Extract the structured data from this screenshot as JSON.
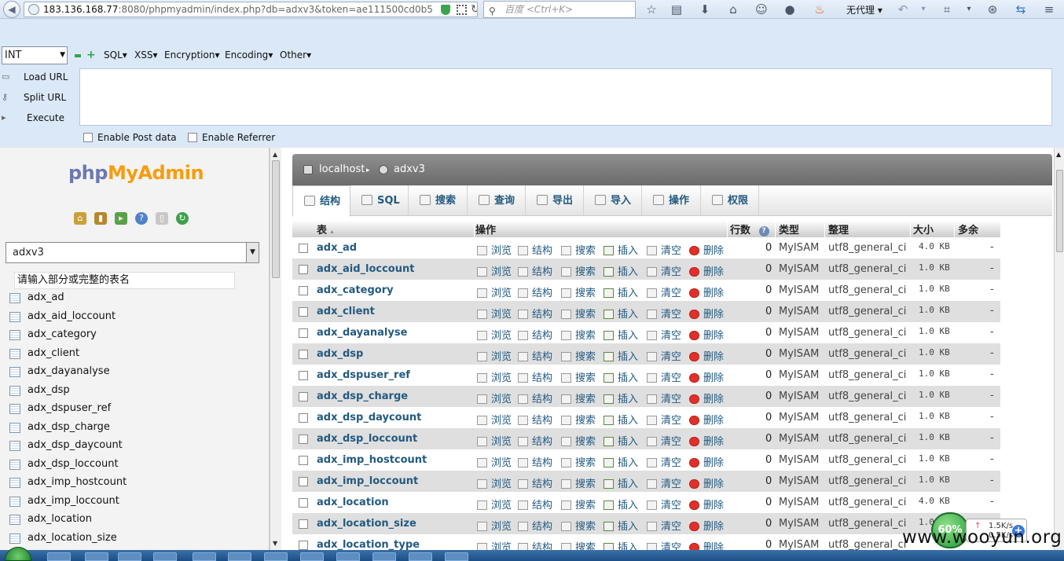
{
  "browser": {
    "url_host": "183.136.168.77",
    "url_rest": ":8080/phpmyadmin/index.php?db=adxv3&token=ae111500cd0b5",
    "search_placeholder": "百度 <Ctrl+K>",
    "proxy_label": "无代理",
    "icons": [
      "back-icon",
      "globe-icon",
      "shield-icon",
      "qr-icon",
      "reload-icon",
      "search-icon",
      "star-icon",
      "bookmarks-icon",
      "download-icon",
      "home-icon",
      "chat-icon",
      "comment-icon",
      "fire-icon",
      "undo-icon",
      "crop-icon",
      "globe-settings-icon",
      "sync-icon",
      "menu-icon"
    ]
  },
  "hackbar": {
    "type_select": "INT",
    "menus": [
      "SQL",
      "XSS",
      "Encryption",
      "Encoding",
      "Other"
    ],
    "load_url": "Load URL",
    "split_url": "Split URL",
    "execute": "Execute",
    "post_label": "Enable Post data",
    "referrer_label": "Enable Referrer"
  },
  "sidebar": {
    "logo_php": "php",
    "logo_my": "My",
    "logo_admin": "Admin",
    "db_selected": "adxv3",
    "filter_placeholder": "请输入部分或完整的表名",
    "tables": [
      "adx_ad",
      "adx_aid_loccount",
      "adx_category",
      "adx_client",
      "adx_dayanalyse",
      "adx_dsp",
      "adx_dspuser_ref",
      "adx_dsp_charge",
      "adx_dsp_daycount",
      "adx_dsp_loccount",
      "adx_imp_hostcount",
      "adx_imp_loccount",
      "adx_location",
      "adx_location_size"
    ]
  },
  "breadcrumb": {
    "server": "localhost",
    "db": "adxv3"
  },
  "tabs": [
    "结构",
    "SQL",
    "搜索",
    "查询",
    "导出",
    "导入",
    "操作",
    "权限"
  ],
  "grid": {
    "headers": {
      "table": "表",
      "actions": "操作",
      "rows": "行数",
      "type": "类型",
      "collation": "整理",
      "size": "大小",
      "overhead": "多余"
    },
    "action_labels": [
      "浏览",
      "结构",
      "搜索",
      "插入",
      "清空",
      "删除"
    ],
    "rows": [
      {
        "name": "adx_ad",
        "rows": "0",
        "type": "MyISAM",
        "collation": "utf8_general_ci",
        "size": "4.0 KB",
        "overhead": "-"
      },
      {
        "name": "adx_aid_loccount",
        "rows": "0",
        "type": "MyISAM",
        "collation": "utf8_general_ci",
        "size": "1.0 KB",
        "overhead": "-"
      },
      {
        "name": "adx_category",
        "rows": "0",
        "type": "MyISAM",
        "collation": "utf8_general_ci",
        "size": "1.0 KB",
        "overhead": "-"
      },
      {
        "name": "adx_client",
        "rows": "0",
        "type": "MyISAM",
        "collation": "utf8_general_ci",
        "size": "1.0 KB",
        "overhead": "-"
      },
      {
        "name": "adx_dayanalyse",
        "rows": "0",
        "type": "MyISAM",
        "collation": "utf8_general_ci",
        "size": "1.0 KB",
        "overhead": "-"
      },
      {
        "name": "adx_dsp",
        "rows": "0",
        "type": "MyISAM",
        "collation": "utf8_general_ci",
        "size": "1.0 KB",
        "overhead": "-"
      },
      {
        "name": "adx_dspuser_ref",
        "rows": "0",
        "type": "MyISAM",
        "collation": "utf8_general_ci",
        "size": "1.0 KB",
        "overhead": "-"
      },
      {
        "name": "adx_dsp_charge",
        "rows": "0",
        "type": "MyISAM",
        "collation": "utf8_general_ci",
        "size": "1.0 KB",
        "overhead": "-"
      },
      {
        "name": "adx_dsp_daycount",
        "rows": "0",
        "type": "MyISAM",
        "collation": "utf8_general_ci",
        "size": "1.0 KB",
        "overhead": "-"
      },
      {
        "name": "adx_dsp_loccount",
        "rows": "0",
        "type": "MyISAM",
        "collation": "utf8_general_ci",
        "size": "1.0 KB",
        "overhead": "-"
      },
      {
        "name": "adx_imp_hostcount",
        "rows": "0",
        "type": "MyISAM",
        "collation": "utf8_general_ci",
        "size": "1.0 KB",
        "overhead": "-"
      },
      {
        "name": "adx_imp_loccount",
        "rows": "0",
        "type": "MyISAM",
        "collation": "utf8_general_ci",
        "size": "1.0 KB",
        "overhead": "-"
      },
      {
        "name": "adx_location",
        "rows": "0",
        "type": "MyISAM",
        "collation": "utf8_general_ci",
        "size": "4.0 KB",
        "overhead": "-"
      },
      {
        "name": "adx_location_size",
        "rows": "0",
        "type": "MyISAM",
        "collation": "utf8_general_ci",
        "size": "1.0",
        "overhead": "-"
      },
      {
        "name": "adx_location_type",
        "rows": "0",
        "type": "MyISAM",
        "collation": "utf8_general_ci",
        "size": "",
        "overhead": ""
      }
    ]
  },
  "widget": {
    "percent": "60%",
    "up": "1.5K/s",
    "down": "0.5K/s"
  },
  "watermark": "www.wooyun.org",
  "colors": {
    "link": "#235a81",
    "logo_php": "#6c78af",
    "logo_myadmin": "#f89c0e",
    "hackbar_bg": "#dbe8f8"
  }
}
